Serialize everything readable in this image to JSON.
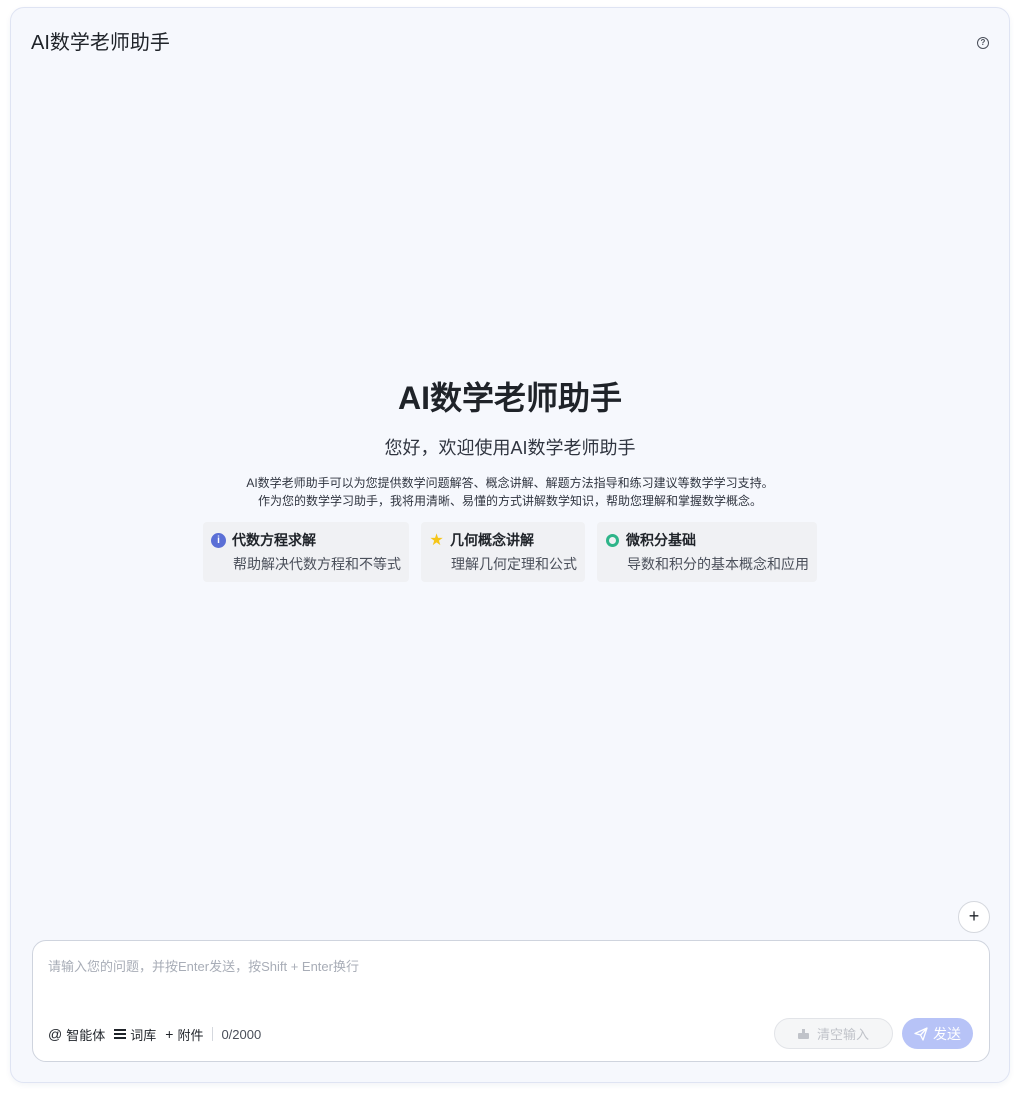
{
  "header": {
    "title": "AI数学老师助手",
    "help_icon_glyph": "?"
  },
  "welcome": {
    "title": "AI数学老师助手",
    "subtitle": "您好，欢迎使用AI数学老师助手",
    "description_line1": "AI数学老师助手可以为您提供数学问题解答、概念讲解、解题方法指导和练习建议等数学学习支持。",
    "description_line2": "作为您的数学学习助手，我将用清晰、易懂的方式讲解数学知识，帮助您理解和掌握数学概念。"
  },
  "features": [
    {
      "icon": "info-icon",
      "title": "代数方程求解",
      "desc": "帮助解决代数方程和不等式"
    },
    {
      "icon": "star-icon",
      "title": "几何概念讲解",
      "desc": "理解几何定理和公式"
    },
    {
      "icon": "ring-icon",
      "title": "微积分基础",
      "desc": "导数和积分的基本概念和应用"
    }
  ],
  "new_chat": {
    "glyph": "+"
  },
  "input": {
    "placeholder": "请输入您的问题，并按Enter发送，按Shift + Enter换行",
    "value": "",
    "agent_label": "智能体",
    "lexicon_label": "词库",
    "attach_label": "附件",
    "char_count": "0/2000",
    "clear_label": "清空输入",
    "send_label": "发送"
  },
  "colors": {
    "accent": "#5b6fd6",
    "send_disabled": "#b7c3f7",
    "star": "#f5c518",
    "ring": "#2fb58a",
    "panel_bg": "#f6f8fd"
  }
}
